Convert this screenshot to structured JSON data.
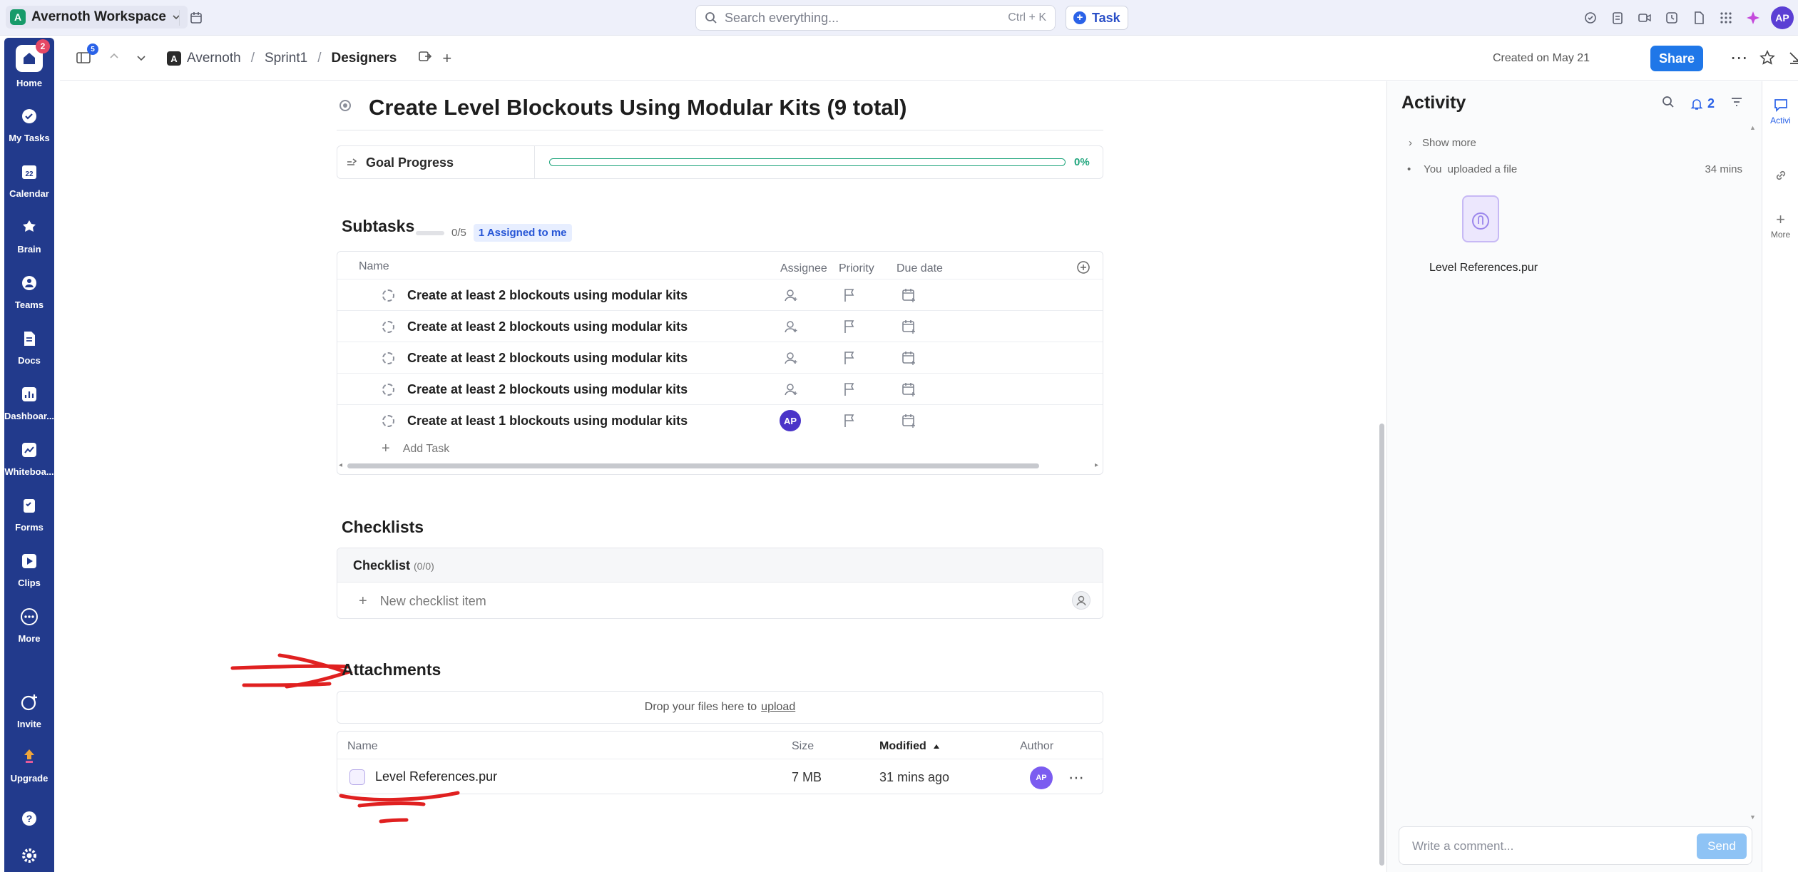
{
  "topbar": {
    "workspace": "Avernoth Workspace",
    "workspace_initial": "A",
    "search_placeholder": "Search everything...",
    "search_shortcut": "Ctrl + K",
    "task_button": "Task",
    "avatar": "AP"
  },
  "rail": {
    "home_badge": "2",
    "calendar_day": "22",
    "items": [
      {
        "label": "Home",
        "icon": "home-icon"
      },
      {
        "label": "My Tasks",
        "icon": "check-circle-icon"
      },
      {
        "label": "Calendar",
        "icon": "calendar-icon"
      },
      {
        "label": "Brain",
        "icon": "brain-icon"
      },
      {
        "label": "Teams",
        "icon": "teams-icon"
      },
      {
        "label": "Docs",
        "icon": "docs-icon"
      },
      {
        "label": "Dashboar...",
        "icon": "dashboard-icon"
      },
      {
        "label": "Whiteboa...",
        "icon": "whiteboard-icon"
      },
      {
        "label": "Forms",
        "icon": "forms-icon"
      },
      {
        "label": "Clips",
        "icon": "clips-icon"
      },
      {
        "label": "More",
        "icon": "more-icon"
      },
      {
        "label": "Invite",
        "icon": "invite-icon"
      },
      {
        "label": "Upgrade",
        "icon": "upgrade-icon"
      }
    ]
  },
  "header": {
    "sidebar_badge": "5",
    "workspace_initial": "A",
    "crumbs": [
      "Avernoth",
      "Sprint1",
      "Designers"
    ],
    "separator": "/",
    "created": "Created on May 21",
    "share": "Share"
  },
  "task": {
    "title": "Create Level Blockouts Using Modular Kits (9 total)",
    "goal_label": "Goal Progress",
    "goal_percent": "0%",
    "goal_progress_value": 0
  },
  "subtasks": {
    "heading": "Subtasks",
    "count": "0/5",
    "assigned_chip": "1 Assigned to me",
    "columns": {
      "name": "Name",
      "assignee": "Assignee",
      "priority": "Priority",
      "due": "Due date"
    },
    "rows": [
      {
        "name": "Create at least 2 blockouts using modular kits",
        "assignee": ""
      },
      {
        "name": "Create at least 2 blockouts using modular kits",
        "assignee": ""
      },
      {
        "name": "Create at least 2 blockouts using modular kits",
        "assignee": ""
      },
      {
        "name": "Create at least 2 blockouts using modular kits",
        "assignee": ""
      },
      {
        "name": "Create at least 1 blockouts using modular kits",
        "assignee": "AP"
      }
    ],
    "add_task": "Add Task"
  },
  "checklists": {
    "heading": "Checklists",
    "checklist_title": "Checklist",
    "checklist_count": "(0/0)",
    "new_item": "New checklist item"
  },
  "attachments": {
    "heading": "Attachments",
    "drop_text": "Drop your files here to",
    "upload_link": "upload",
    "columns": {
      "name": "Name",
      "size": "Size",
      "modified": "Modified",
      "author": "Author"
    },
    "rows": [
      {
        "name": "Level References.pur",
        "size": "7 MB",
        "modified": "31 mins ago",
        "author": "AP"
      }
    ]
  },
  "activity": {
    "title": "Activity",
    "notification_count": "2",
    "show_more": "Show more",
    "event_actor": "You",
    "event_text": "uploaded a file",
    "event_time": "34 mins",
    "file_name": "Level References.pur",
    "comment_placeholder": "Write a comment...",
    "send": "Send"
  },
  "right_sidebar": {
    "items": [
      {
        "label": "Activi",
        "icon": "comment-icon"
      },
      {
        "label": "",
        "icon": "link-icon"
      },
      {
        "label": "More",
        "icon": "plus-icon"
      }
    ]
  },
  "colors": {
    "rail": "#223a8c",
    "accent": "#1f77e8",
    "progress": "#1fa57c",
    "annotation": "#e02020"
  }
}
